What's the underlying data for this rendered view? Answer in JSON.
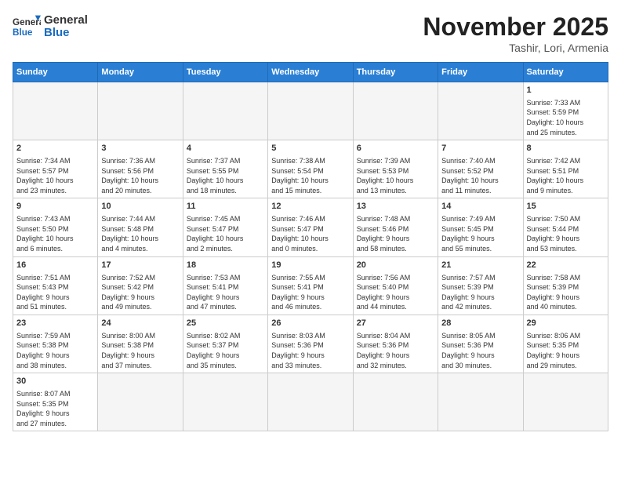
{
  "header": {
    "logo_general": "General",
    "logo_blue": "Blue",
    "month": "November 2025",
    "location": "Tashir, Lori, Armenia"
  },
  "weekdays": [
    "Sunday",
    "Monday",
    "Tuesday",
    "Wednesday",
    "Thursday",
    "Friday",
    "Saturday"
  ],
  "days": [
    {
      "num": "",
      "info": ""
    },
    {
      "num": "",
      "info": ""
    },
    {
      "num": "",
      "info": ""
    },
    {
      "num": "",
      "info": ""
    },
    {
      "num": "",
      "info": ""
    },
    {
      "num": "",
      "info": ""
    },
    {
      "num": "1",
      "info": "Sunrise: 7:33 AM\nSunset: 5:59 PM\nDaylight: 10 hours\nand 25 minutes."
    },
    {
      "num": "2",
      "info": "Sunrise: 7:34 AM\nSunset: 5:57 PM\nDaylight: 10 hours\nand 23 minutes."
    },
    {
      "num": "3",
      "info": "Sunrise: 7:36 AM\nSunset: 5:56 PM\nDaylight: 10 hours\nand 20 minutes."
    },
    {
      "num": "4",
      "info": "Sunrise: 7:37 AM\nSunset: 5:55 PM\nDaylight: 10 hours\nand 18 minutes."
    },
    {
      "num": "5",
      "info": "Sunrise: 7:38 AM\nSunset: 5:54 PM\nDaylight: 10 hours\nand 15 minutes."
    },
    {
      "num": "6",
      "info": "Sunrise: 7:39 AM\nSunset: 5:53 PM\nDaylight: 10 hours\nand 13 minutes."
    },
    {
      "num": "7",
      "info": "Sunrise: 7:40 AM\nSunset: 5:52 PM\nDaylight: 10 hours\nand 11 minutes."
    },
    {
      "num": "8",
      "info": "Sunrise: 7:42 AM\nSunset: 5:51 PM\nDaylight: 10 hours\nand 9 minutes."
    },
    {
      "num": "9",
      "info": "Sunrise: 7:43 AM\nSunset: 5:50 PM\nDaylight: 10 hours\nand 6 minutes."
    },
    {
      "num": "10",
      "info": "Sunrise: 7:44 AM\nSunset: 5:48 PM\nDaylight: 10 hours\nand 4 minutes."
    },
    {
      "num": "11",
      "info": "Sunrise: 7:45 AM\nSunset: 5:47 PM\nDaylight: 10 hours\nand 2 minutes."
    },
    {
      "num": "12",
      "info": "Sunrise: 7:46 AM\nSunset: 5:47 PM\nDaylight: 10 hours\nand 0 minutes."
    },
    {
      "num": "13",
      "info": "Sunrise: 7:48 AM\nSunset: 5:46 PM\nDaylight: 9 hours\nand 58 minutes."
    },
    {
      "num": "14",
      "info": "Sunrise: 7:49 AM\nSunset: 5:45 PM\nDaylight: 9 hours\nand 55 minutes."
    },
    {
      "num": "15",
      "info": "Sunrise: 7:50 AM\nSunset: 5:44 PM\nDaylight: 9 hours\nand 53 minutes."
    },
    {
      "num": "16",
      "info": "Sunrise: 7:51 AM\nSunset: 5:43 PM\nDaylight: 9 hours\nand 51 minutes."
    },
    {
      "num": "17",
      "info": "Sunrise: 7:52 AM\nSunset: 5:42 PM\nDaylight: 9 hours\nand 49 minutes."
    },
    {
      "num": "18",
      "info": "Sunrise: 7:53 AM\nSunset: 5:41 PM\nDaylight: 9 hours\nand 47 minutes."
    },
    {
      "num": "19",
      "info": "Sunrise: 7:55 AM\nSunset: 5:41 PM\nDaylight: 9 hours\nand 46 minutes."
    },
    {
      "num": "20",
      "info": "Sunrise: 7:56 AM\nSunset: 5:40 PM\nDaylight: 9 hours\nand 44 minutes."
    },
    {
      "num": "21",
      "info": "Sunrise: 7:57 AM\nSunset: 5:39 PM\nDaylight: 9 hours\nand 42 minutes."
    },
    {
      "num": "22",
      "info": "Sunrise: 7:58 AM\nSunset: 5:39 PM\nDaylight: 9 hours\nand 40 minutes."
    },
    {
      "num": "23",
      "info": "Sunrise: 7:59 AM\nSunset: 5:38 PM\nDaylight: 9 hours\nand 38 minutes."
    },
    {
      "num": "24",
      "info": "Sunrise: 8:00 AM\nSunset: 5:38 PM\nDaylight: 9 hours\nand 37 minutes."
    },
    {
      "num": "25",
      "info": "Sunrise: 8:02 AM\nSunset: 5:37 PM\nDaylight: 9 hours\nand 35 minutes."
    },
    {
      "num": "26",
      "info": "Sunrise: 8:03 AM\nSunset: 5:36 PM\nDaylight: 9 hours\nand 33 minutes."
    },
    {
      "num": "27",
      "info": "Sunrise: 8:04 AM\nSunset: 5:36 PM\nDaylight: 9 hours\nand 32 minutes."
    },
    {
      "num": "28",
      "info": "Sunrise: 8:05 AM\nSunset: 5:36 PM\nDaylight: 9 hours\nand 30 minutes."
    },
    {
      "num": "29",
      "info": "Sunrise: 8:06 AM\nSunset: 5:35 PM\nDaylight: 9 hours\nand 29 minutes."
    },
    {
      "num": "30",
      "info": "Sunrise: 8:07 AM\nSunset: 5:35 PM\nDaylight: 9 hours\nand 27 minutes."
    },
    {
      "num": "",
      "info": ""
    },
    {
      "num": "",
      "info": ""
    },
    {
      "num": "",
      "info": ""
    },
    {
      "num": "",
      "info": ""
    },
    {
      "num": "",
      "info": ""
    },
    {
      "num": "",
      "info": ""
    }
  ]
}
